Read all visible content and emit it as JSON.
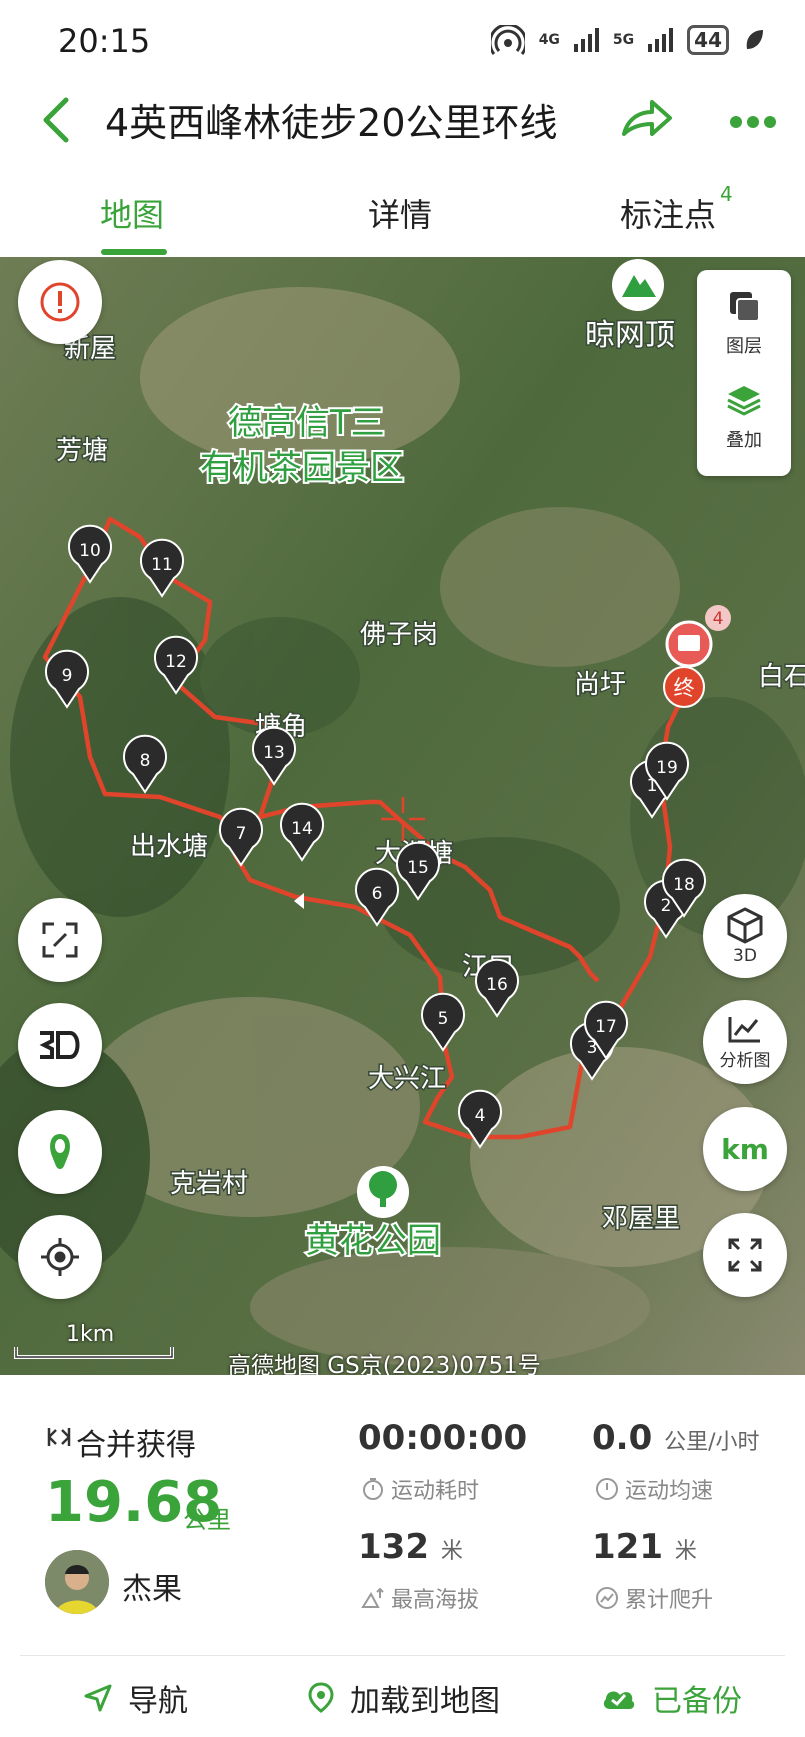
{
  "status_bar": {
    "time": "20:15",
    "network1": "4G",
    "network2": "5G",
    "battery": "44"
  },
  "header": {
    "title": "4英西峰林徒步20公里环线"
  },
  "tabs": [
    {
      "label": "地图"
    },
    {
      "label": "详情"
    },
    {
      "label": "标注点",
      "badge": "4"
    }
  ],
  "map": {
    "places": [
      "新屋",
      "芳塘",
      "德高信T三",
      "有机茶园景区",
      "晾网顶",
      "佛子岗",
      "尚圩",
      "白石",
      "塘角",
      "出水塘",
      "大湖塘",
      "江口",
      "大兴江",
      "克岩村",
      "黄花公园",
      "邓屋里"
    ],
    "end_marker": "终",
    "photo_count": "4",
    "waypoints": [
      "1",
      "2",
      "3",
      "4",
      "5",
      "6",
      "7",
      "8",
      "9",
      "10",
      "11",
      "12",
      "13",
      "14",
      "15",
      "16",
      "17",
      "18",
      "19"
    ],
    "layer_panel": {
      "layers_label": "图层",
      "overlay_label": "叠加"
    },
    "buttons": {
      "view3d_label": "3D",
      "analysis_label": "分析图",
      "km_label": "km"
    },
    "scale_label": "1km",
    "attribution": "高德地图 GS京(2023)0751号"
  },
  "stats": {
    "merged_label": "合并获得",
    "distance_value": "19.68",
    "distance_unit": "公里",
    "user_name": "杰果",
    "duration_value": "00:00:00",
    "duration_caption": "运动耗时",
    "speed_value": "0.0",
    "speed_unit": "公里/小时",
    "speed_caption": "运动均速",
    "max_altitude_value": "132",
    "max_altitude_unit": "米",
    "max_altitude_caption": "最高海拔",
    "climb_value": "121",
    "climb_unit": "米",
    "climb_caption": "累计爬升"
  },
  "actions": {
    "navigate": "导航",
    "load_to_map": "加载到地图",
    "backed_up": "已备份"
  },
  "colors": {
    "accent": "#3aa33a",
    "route": "#e0452c",
    "pin": "#2b2b2b"
  }
}
